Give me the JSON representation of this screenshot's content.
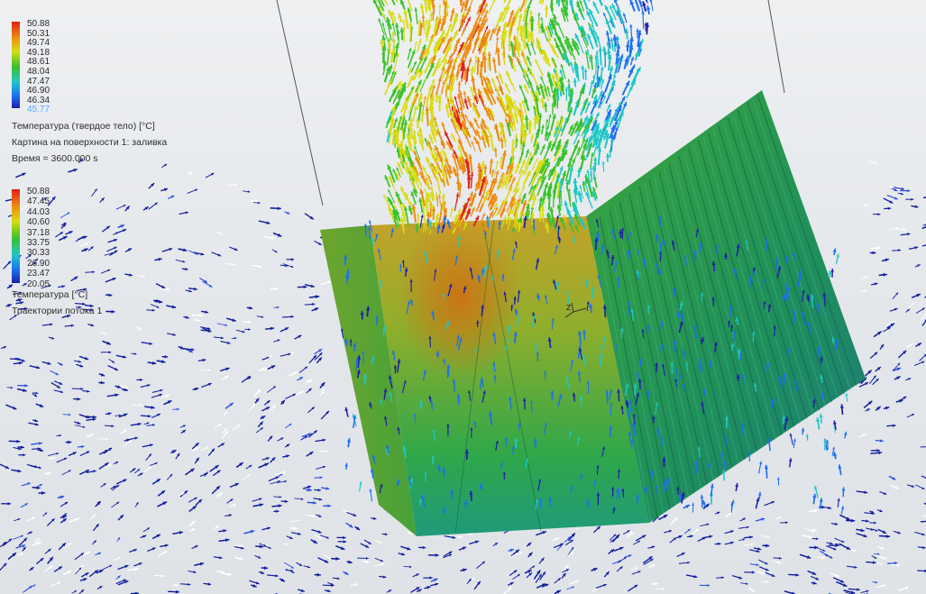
{
  "legend_solid": {
    "ticks": [
      "50.88",
      "50.31",
      "49.74",
      "49.18",
      "48.61",
      "48.04",
      "47.47",
      "46.90",
      "46.34",
      "45.77"
    ],
    "quantity_label": "Температура (твердое тело) [°C]",
    "surface_plot_label": "Картина на поверхности 1: заливка",
    "time_label": "Время = 3600.000 s"
  },
  "legend_fluid": {
    "ticks": [
      "50.88",
      "47.45",
      "44.03",
      "40.60",
      "37.18",
      "33.75",
      "30.33",
      "26.90",
      "23.47",
      "20.05"
    ],
    "quantity_label": "Температура [°C]",
    "flow_trajectories_label": "Траектории потока 1"
  },
  "colors": {
    "colormap": [
      "#1c1fa8",
      "#1d6ff0",
      "#1ec7c6",
      "#39c22a",
      "#d8dc10",
      "#ee8a10",
      "#e0201a"
    ],
    "background": "#e6e9ec",
    "slow_flow": "#0e1a9c"
  },
  "icons": {
    "triad": "axis-triad-icon"
  }
}
